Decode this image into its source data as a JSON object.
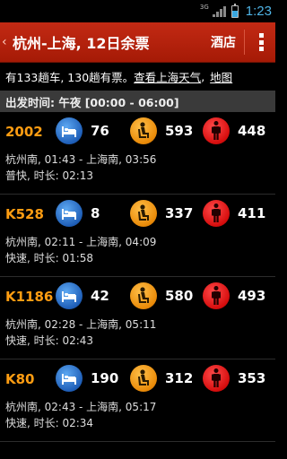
{
  "status_bar": {
    "network": "3G",
    "time": "1:23",
    "battery_icon": "battery-charging-icon",
    "signal_icon": "signal-icon"
  },
  "action_bar": {
    "title": "杭州-上海, 12日余票",
    "hotel_label": "酒店",
    "back_icon": "back-chevron-icon",
    "menu_icon": "overflow-menu-icon",
    "color": "#b2200b"
  },
  "summary": {
    "text": "有133趟车, 130趟有票。",
    "weather_link": "查看上海天气",
    "separator": ",",
    "map_link": "地图"
  },
  "section": {
    "label": "出发时间: 午夜 [00:00 - 06:00]"
  },
  "trains": [
    {
      "number": "2002",
      "sleeper": "76",
      "seat": "593",
      "standing": "448",
      "route": "杭州南, 01:43  -  上海南, 03:56",
      "meta": "普快, 时长: 02:13"
    },
    {
      "number": "K528",
      "sleeper": "8",
      "seat": "337",
      "standing": "411",
      "route": "杭州南, 02:11  -  上海南, 04:09",
      "meta": "快速, 时长: 01:58"
    },
    {
      "number": "K1186",
      "sleeper": "42",
      "seat": "580",
      "standing": "493",
      "route": "杭州南, 02:28  -  上海南, 05:11",
      "meta": "快速, 时长: 02:43"
    },
    {
      "number": "K80",
      "sleeper": "190",
      "seat": "312",
      "standing": "353",
      "route": "杭州南, 02:43  -  上海南, 05:17",
      "meta": "快速, 时长: 02:34"
    }
  ],
  "icons": {
    "sleeper": "sleeper-berth-icon",
    "seat": "hard-seat-icon",
    "standing": "standing-person-icon"
  },
  "colors": {
    "train_number": "#ff9d12",
    "sleeper": "#1f5fb8",
    "seat": "#e98a08",
    "standing": "#d60d0d"
  }
}
